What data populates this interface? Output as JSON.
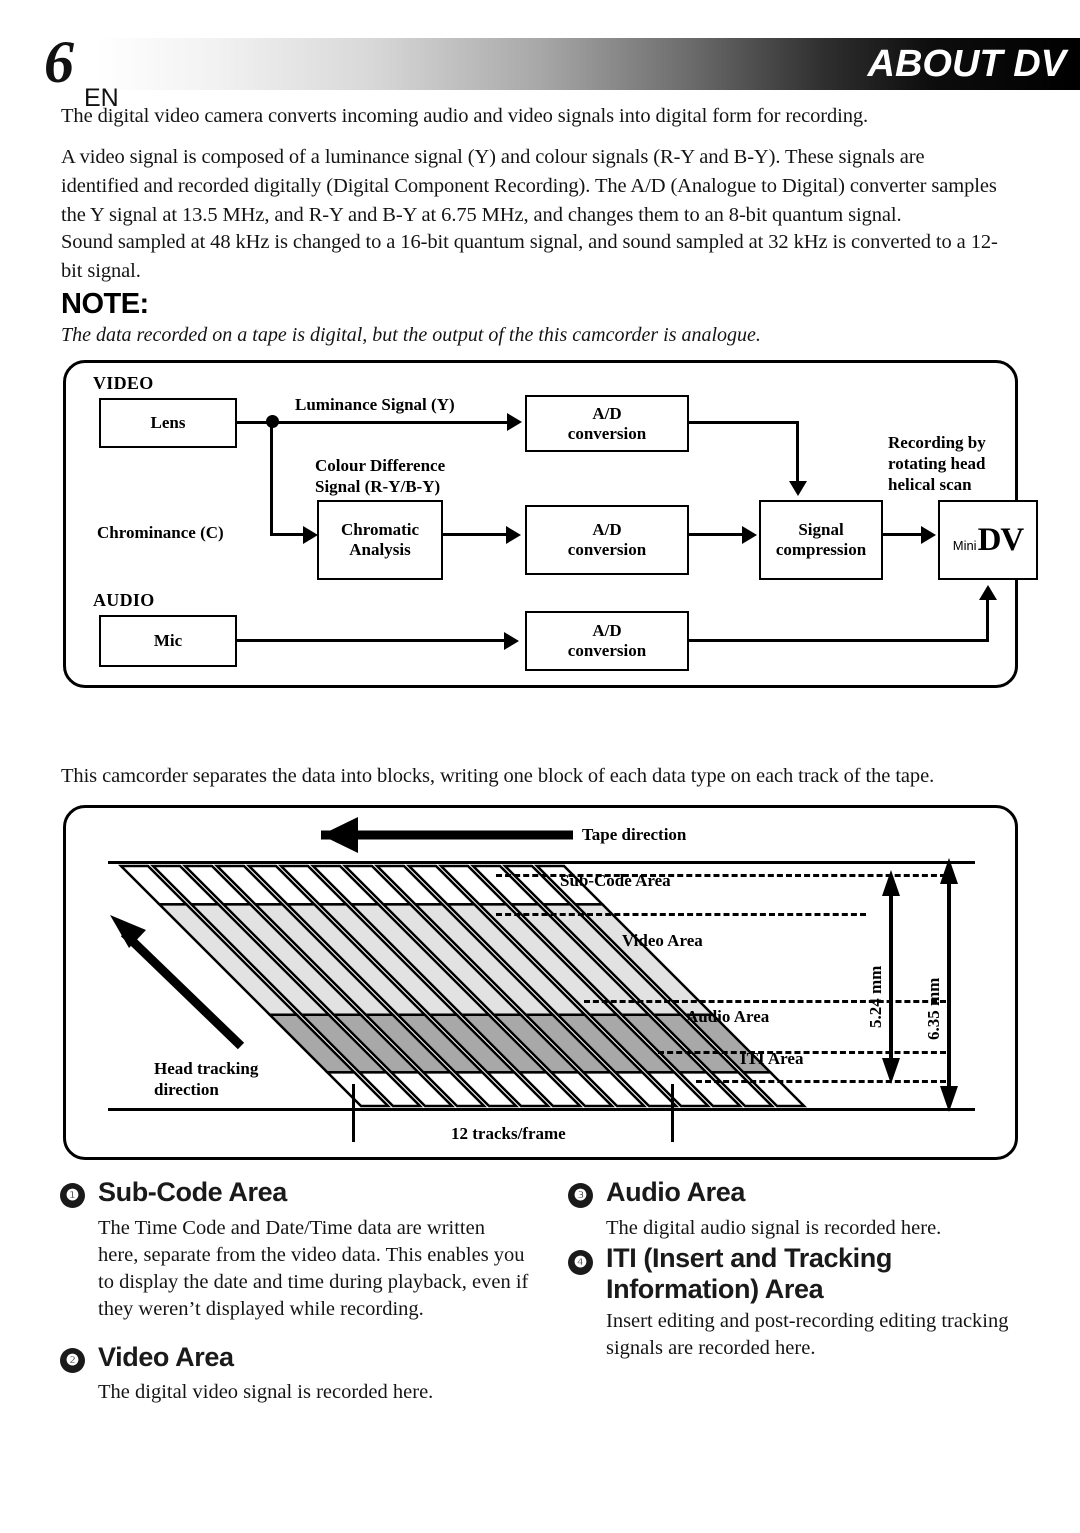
{
  "header": {
    "page_number": "6",
    "language_code": "EN",
    "title": "ABOUT DV"
  },
  "intro": {
    "p1": "The digital video camera converts incoming audio and video signals into digital form for recording.",
    "p2": "A video signal is composed of a luminance signal (Y) and colour signals (R-Y and B-Y). These signals are identified and recorded digitally (Digital Component Recording). The A/D (Analogue to Digital) converter samples the Y signal at 13.5 MHz, and R-Y and B-Y at 6.75 MHz, and changes them to an 8-bit quantum signal.",
    "p3": "Sound sampled at 48 kHz is changed to a 16-bit quantum signal, and sound sampled at 32 kHz is converted to a 12-bit signal."
  },
  "note": {
    "title": "NOTE:",
    "text": "The data recorded on a tape is digital, but the output of the this camcorder is analogue."
  },
  "signal_diagram": {
    "section_video": "VIDEO",
    "section_audio": "AUDIO",
    "boxes": {
      "lens": "Lens",
      "chromatic_analysis": "Chromatic\nAnalysis",
      "ad_luminance": "A/D\nconversion",
      "ad_chroma": "A/D\nconversion",
      "ad_audio": "A/D\nconversion",
      "signal_compression": "Signal\ncompression",
      "mic": "Mic"
    },
    "labels": {
      "luminance": "Luminance Signal (Y)",
      "colour_difference_l1": "Colour Difference",
      "colour_difference_l2": "Signal (R-Y/B-Y)",
      "chrominance": "Chrominance (C)",
      "recording_l1": "Recording by",
      "recording_l2": "rotating head",
      "recording_l3": "helical scan"
    },
    "cassette": {
      "mini": "Mini",
      "dv": "DV"
    }
  },
  "tape_intro": "This camcorder separates the data into blocks, writing one block of each data type on each track of the tape.",
  "tape_diagram": {
    "tape_direction": "Tape direction",
    "head_tracking_l1": "Head tracking",
    "head_tracking_l2": "direction",
    "tracks_per_frame": "12 tracks/frame",
    "areas": [
      "Sub-Code Area",
      "Video Area",
      "Audio Area",
      "ITI Area"
    ],
    "dimension_inner": "5.24 mm",
    "dimension_outer": "6.35 mm",
    "track_count": 14,
    "colors": {
      "video_fill": "#e2e2e2",
      "audio_fill": "#a8a8a8",
      "subcode_fill": "#ffffff",
      "iti_fill": "#ffffff"
    }
  },
  "sections": [
    {
      "number": "❶",
      "title": "Sub-Code Area",
      "body": "The Time Code and Date/Time data are written here, separate from the video data. This enables you to display the date and time during playback, even if they weren’t displayed while recording."
    },
    {
      "number": "❷",
      "title": "Video Area",
      "body": "The digital video signal is recorded here."
    },
    {
      "number": "❸",
      "title": "Audio Area",
      "body": "The digital audio signal is recorded here."
    },
    {
      "number": "❹",
      "title": "ITI (Insert and Tracking Information) Area",
      "body": "Insert editing and post-recording editing tracking signals are recorded here."
    }
  ]
}
